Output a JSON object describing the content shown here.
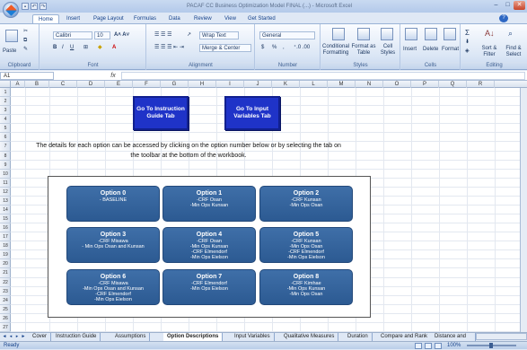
{
  "window": {
    "title": "PACAF CC Business Optimization Model FINAL (...) - Microsoft Excel",
    "buttons": {
      "minimize": "–",
      "maximize": "□",
      "close": "✕"
    }
  },
  "ribbon": {
    "tabs": [
      "Home",
      "Insert",
      "Page Layout",
      "Formulas",
      "Data",
      "Review",
      "View",
      "Get Started"
    ],
    "active_tab": "Home",
    "clipboard": {
      "paste": "Paste",
      "label": "Clipboard"
    },
    "font": {
      "name": "Calibri",
      "size": "10",
      "label": "Font"
    },
    "alignment": {
      "wrap": "Wrap Text",
      "merge": "Merge & Center",
      "label": "Alignment"
    },
    "number": {
      "format": "General",
      "currency": "$",
      "percent": "%",
      "comma": ",",
      "label": "Number"
    },
    "styles": {
      "conditional": "Conditional Formatting",
      "format_table": "Format as Table",
      "cell_styles": "Cell Styles",
      "label": "Styles"
    },
    "cells": {
      "insert": "Insert",
      "delete": "Delete",
      "format": "Format",
      "label": "Cells"
    },
    "editing": {
      "sort": "Sort & Filter",
      "find": "Find & Select",
      "label": "Editing"
    }
  },
  "formula_bar": {
    "name_box": "A1",
    "fx": "fx",
    "value": ""
  },
  "grid": {
    "columns": [
      "A",
      "B",
      "C",
      "D",
      "E",
      "F",
      "G",
      "H",
      "I",
      "J",
      "K",
      "L",
      "M",
      "N",
      "O",
      "P",
      "Q",
      "R"
    ],
    "rows": [
      "1",
      "2",
      "3",
      "4",
      "5",
      "6",
      "7",
      "8",
      "9",
      "10",
      "11",
      "12",
      "13",
      "14",
      "15",
      "16",
      "17",
      "18",
      "19",
      "20",
      "21",
      "22",
      "23",
      "24",
      "25",
      "26",
      "27"
    ]
  },
  "sheet": {
    "btn_instruction": "Go To Instruction Guide Tab",
    "btn_input": "Go To Input Variables Tab",
    "description": "The details for each option can be accessed by clicking on the option number below or by selecting the tab on the toolbar at the bottom of the workbook.",
    "options": [
      {
        "title": "Option 0",
        "lines": [
          "- BASELINE"
        ]
      },
      {
        "title": "Option 1",
        "lines": [
          "-CRF Osan",
          "-Min Ops Kunsan"
        ]
      },
      {
        "title": "Option 2",
        "lines": [
          "-CRF Kunsan",
          "-Min Ops Osan"
        ]
      },
      {
        "title": "Option 3",
        "lines": [
          "-CRF Misawa",
          "- Min Ops Osan and Kunsan"
        ]
      },
      {
        "title": "Option 4",
        "lines": [
          "-CRF Osan",
          "-Min Ops Kunsan",
          "-CRF Elmendorf",
          "-Min Ops Eielson"
        ]
      },
      {
        "title": "Option 5",
        "lines": [
          "-CRF Kunsan",
          "-Min Ops Osan",
          "-CRF Elmendorf",
          "-Min Ops Eielson"
        ]
      },
      {
        "title": "Option 6",
        "lines": [
          "-CRF Misawa",
          "-Min Ops Osan and Kunsan",
          "-CRF Elmendorf",
          "-Min Ops Eielson"
        ]
      },
      {
        "title": "Option 7",
        "lines": [
          "-CRF Elmendorf",
          "-Min Ops Eielson"
        ]
      },
      {
        "title": "Option 8",
        "lines": [
          "-CRF Kimhae",
          "-Min Ops Kunsan",
          "-Min Ops Osan"
        ]
      }
    ]
  },
  "sheet_tabs": [
    "Cover",
    "Instruction Guide",
    "Assumptions",
    "Option Descriptions",
    "Input Variables",
    "Qualitative Measures",
    "Duration",
    "Compare and Rank",
    "Distance and"
  ],
  "active_sheet": "Option Descriptions",
  "status": {
    "text": "Ready",
    "zoom": "100%"
  }
}
